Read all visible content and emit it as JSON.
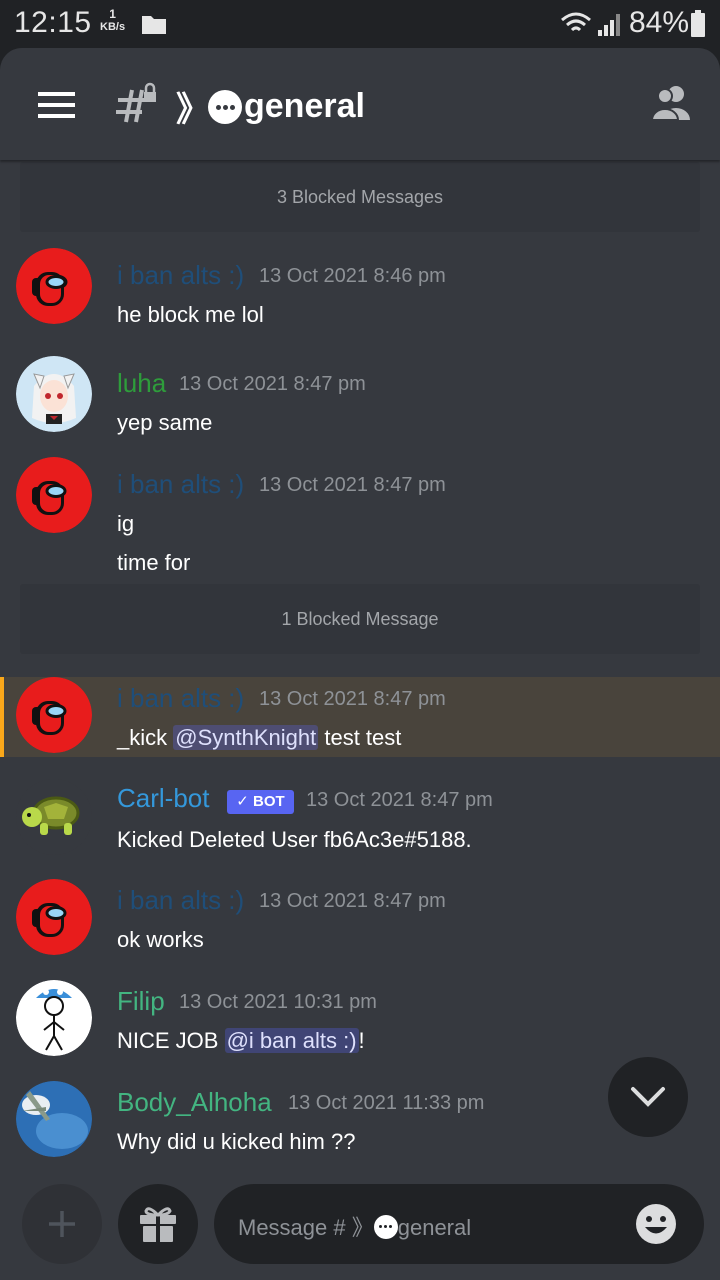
{
  "status_bar": {
    "time": "12:15",
    "net_speed_value": "1",
    "net_speed_unit": "KB/s",
    "battery": "84%"
  },
  "header": {
    "channel_prefix": "》",
    "channel_name": "general",
    "icons": [
      "menu-icon",
      "locked-hash-icon",
      "members-icon"
    ]
  },
  "blocked": [
    {
      "label": "3 Blocked Messages"
    },
    {
      "label": "1 Blocked Message"
    }
  ],
  "messages": [
    {
      "author": "i ban alts :)",
      "author_color": "#1f4e79",
      "time": "13 Oct 2021 8:46 pm",
      "lines": [
        "he block me lol"
      ],
      "avatar": "among-us-red"
    },
    {
      "author": "luha",
      "author_color": "#2e9d3b",
      "time": "13 Oct 2021 8:47 pm",
      "lines": [
        "yep same"
      ],
      "avatar": "anime-girl"
    },
    {
      "author": "i ban alts :)",
      "author_color": "#1f4e79",
      "time": "13 Oct 2021 8:47 pm",
      "lines": [
        "ig",
        "time for"
      ],
      "avatar": "among-us-red"
    },
    {
      "author": "i ban alts :)",
      "author_color": "#1f4e79",
      "time": "13 Oct 2021 8:47 pm",
      "text_before": "_kick ",
      "mention": "@SynthKnight",
      "text_after": " test test",
      "avatar": "among-us-red",
      "highlighted": true
    },
    {
      "author": "Carl-bot",
      "author_color": "#3498db",
      "bot_tag": "BOT",
      "time": "13 Oct 2021 8:47 pm",
      "lines": [
        "Kicked Deleted User fb6Ac3e#5188."
      ],
      "avatar": "turtle"
    },
    {
      "author": "i ban alts :)",
      "author_color": "#1f4e79",
      "time": "13 Oct 2021 8:47 pm",
      "lines": [
        "ok works"
      ],
      "avatar": "among-us-red"
    },
    {
      "author": "Filip",
      "author_color": "#43b581",
      "time": "13 Oct 2021 10:31 pm",
      "text_before": "NICE JOB ",
      "mention": "@i ban alts :)",
      "text_after": "!",
      "avatar": "stick-figure-mushroom"
    },
    {
      "author": "Body_Alhoha",
      "author_color": "#43b581",
      "time": "13 Oct 2021 11:33 pm",
      "lines": [
        "Why did u kicked him ??"
      ],
      "avatar": "plane-sky"
    }
  ],
  "composer": {
    "placeholder_prefix": "Message # 》",
    "placeholder_channel": "general"
  }
}
